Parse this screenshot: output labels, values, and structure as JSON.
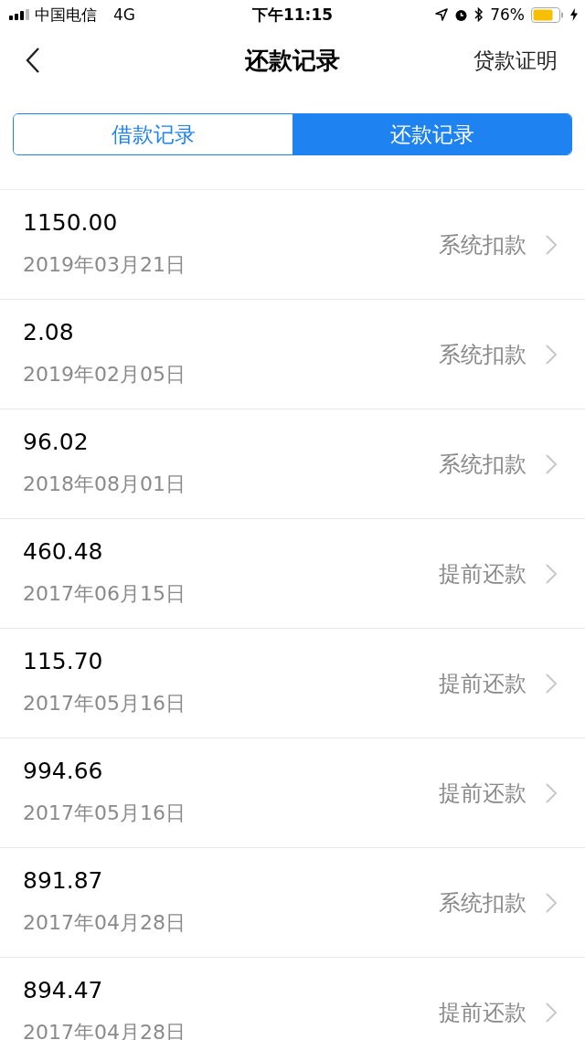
{
  "status_bar": {
    "carrier": "中国电信",
    "network": "4G",
    "time": "下午11:15",
    "battery": "76%"
  },
  "nav": {
    "title": "还款记录",
    "action": "贷款证明"
  },
  "tabs": [
    {
      "label": "借款记录",
      "selected": false
    },
    {
      "label": "还款记录",
      "selected": true
    }
  ],
  "records": [
    {
      "amount": "1150.00",
      "date": "2019年03月21日",
      "method": "系统扣款"
    },
    {
      "amount": "2.08",
      "date": "2019年02月05日",
      "method": "系统扣款"
    },
    {
      "amount": "96.02",
      "date": "2018年08月01日",
      "method": "系统扣款"
    },
    {
      "amount": "460.48",
      "date": "2017年06月15日",
      "method": "提前还款"
    },
    {
      "amount": "115.70",
      "date": "2017年05月16日",
      "method": "提前还款"
    },
    {
      "amount": "994.66",
      "date": "2017年05月16日",
      "method": "提前还款"
    },
    {
      "amount": "891.87",
      "date": "2017年04月28日",
      "method": "系统扣款"
    },
    {
      "amount": "894.47",
      "date": "2017年04月28日",
      "method": "提前还款"
    }
  ]
}
